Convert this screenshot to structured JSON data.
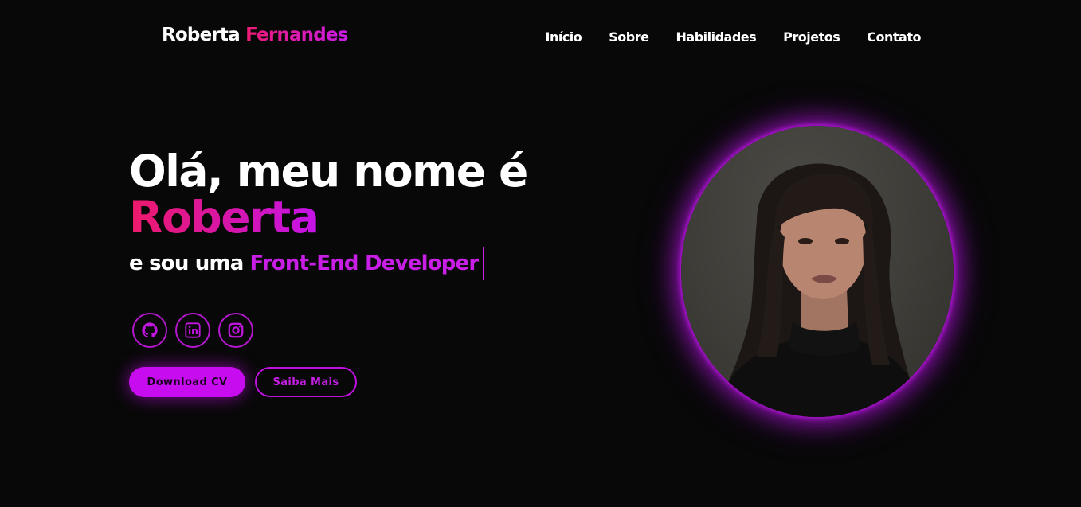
{
  "logo": {
    "first": "Roberta",
    "last": "Fernandes"
  },
  "nav": {
    "items": [
      "Início",
      "Sobre",
      "Habilidades",
      "Projetos",
      "Contato"
    ]
  },
  "hero": {
    "greeting": "Olá, meu nome é",
    "name": "Roberta",
    "subtitle_prefix": "e sou uma",
    "role": "Front-End Developer"
  },
  "socials": [
    {
      "icon": "github-icon"
    },
    {
      "icon": "linkedin-icon"
    },
    {
      "icon": "instagram-icon"
    }
  ],
  "buttons": {
    "primary": "Download CV",
    "secondary": "Saiba Mais"
  },
  "colors": {
    "background": "#080808",
    "accent_pink": "#ee1a73",
    "accent_purple": "#c70cef",
    "text": "#ffffff"
  }
}
